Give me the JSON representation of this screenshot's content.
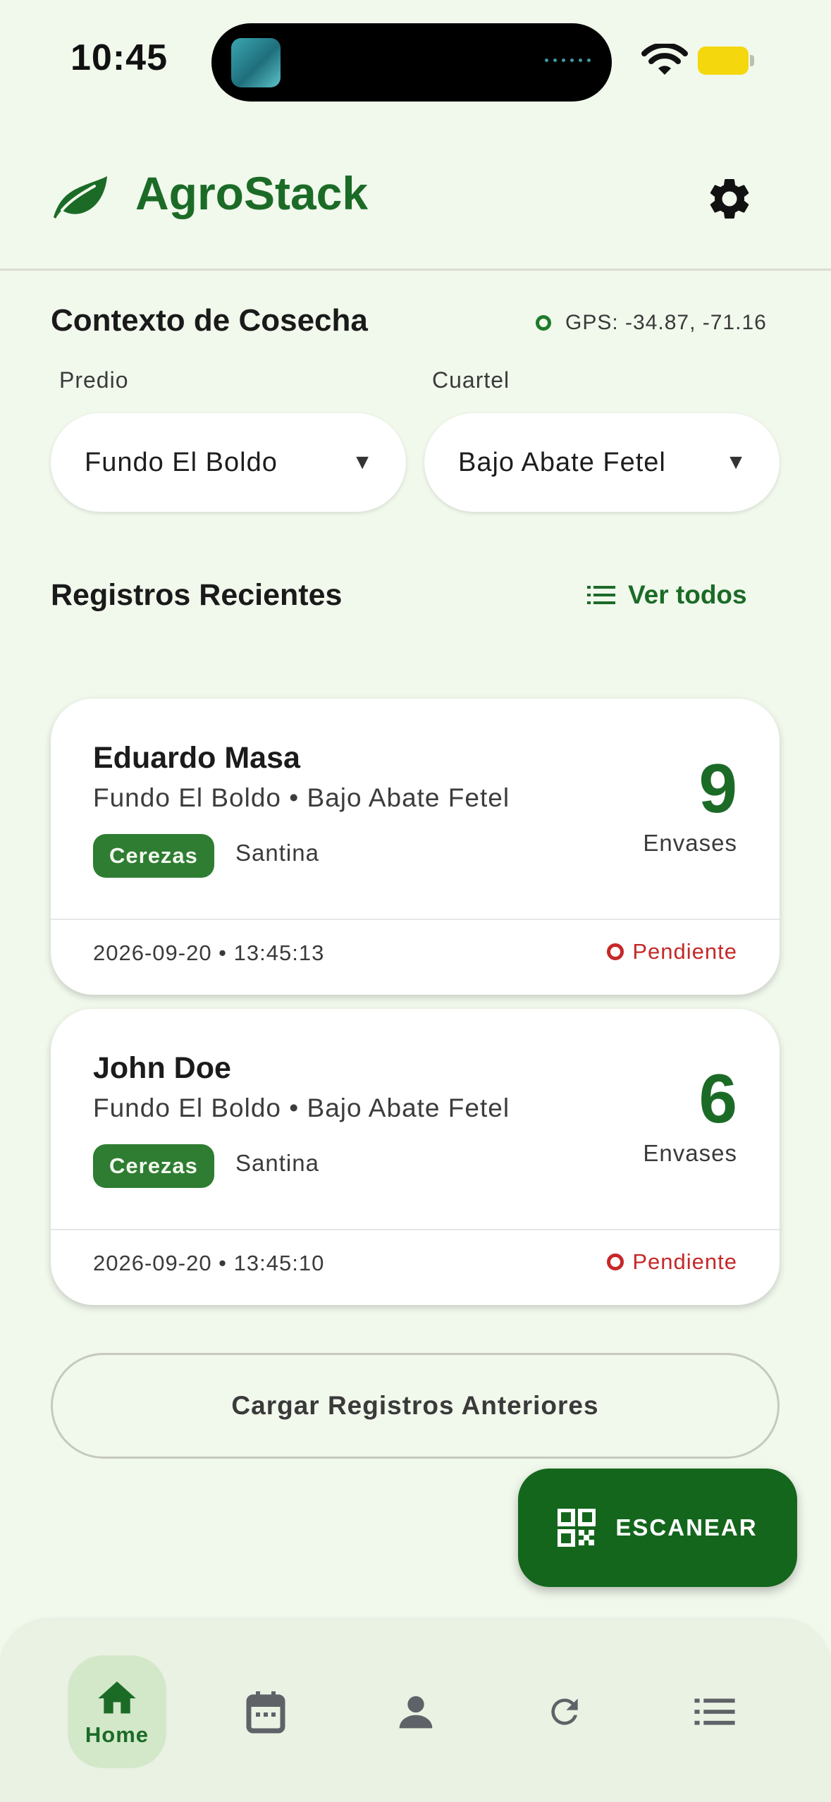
{
  "status_bar": {
    "time": "10:45"
  },
  "header": {
    "title": "AgroStack",
    "icons": [
      "leaf-icon",
      "gear-icon"
    ]
  },
  "context": {
    "title": "Contexto de Cosecha",
    "gps": "GPS: -34.87, -71.16",
    "predio": {
      "label": "Predio",
      "value": "Fundo El Boldo"
    },
    "cuartel": {
      "label": "Cuartel",
      "value": "Bajo Abate Fetel"
    }
  },
  "records": {
    "title": "Registros Recientes",
    "view_all": "Ver todos",
    "items": [
      {
        "name": "Eduardo Masa",
        "location": "Fundo El Boldo • Bajo Abate Fetel",
        "crop": "Cerezas",
        "variety": "Santina",
        "count": "9",
        "unit": "Envases",
        "timestamp": "2026-09-20 • 13:45:13",
        "status": "Pendiente"
      },
      {
        "name": "John Doe",
        "location": "Fundo El Boldo • Bajo Abate Fetel",
        "crop": "Cerezas",
        "variety": "Santina",
        "count": "6",
        "unit": "Envases",
        "timestamp": "2026-09-20 • 13:45:10",
        "status": "Pendiente"
      }
    ],
    "load_more": "Cargar Registros Anteriores"
  },
  "fab": {
    "label": "ESCANEAR",
    "icon": "qr-code-icon"
  },
  "bottom_nav": {
    "home_label": "Home",
    "items": [
      "home-icon",
      "calendar-icon",
      "person-icon",
      "refresh-icon",
      "list-icon"
    ]
  },
  "colors": {
    "brand": "#1b6b27",
    "background": "#f1f8ec",
    "pending": "#c62828",
    "chip": "#2e7d32"
  }
}
